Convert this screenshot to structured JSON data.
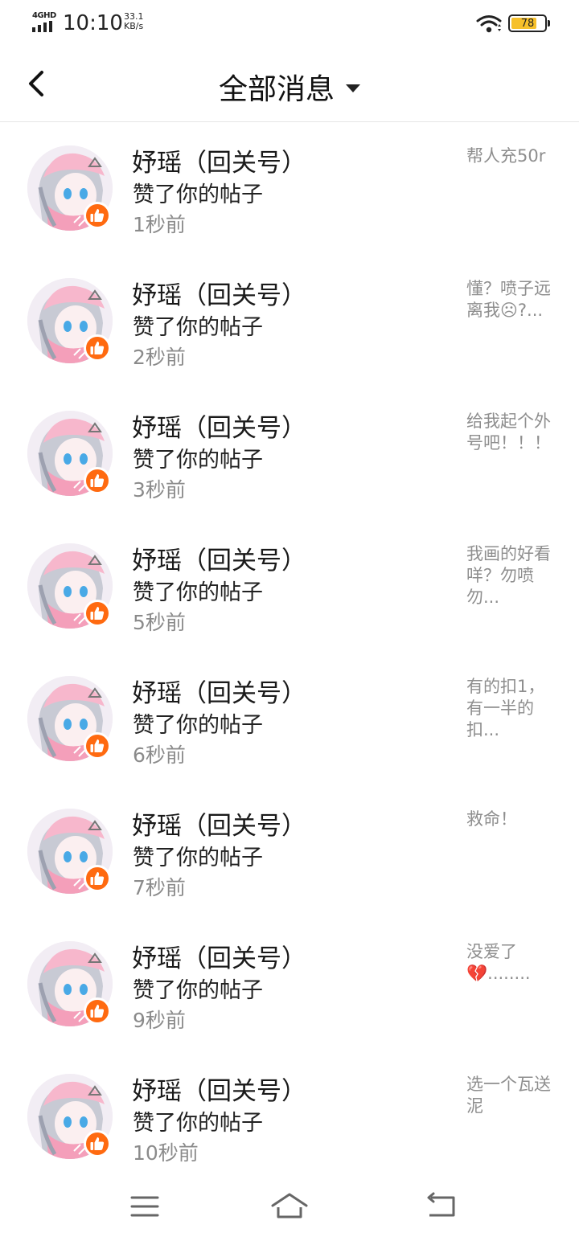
{
  "status_bar": {
    "network": "4GHD",
    "time": "10:10",
    "speed_value": "33.1",
    "speed_unit": "KB/s",
    "battery": "78",
    "battery_level": 0.78
  },
  "header": {
    "title": "全部消息"
  },
  "notifications": [
    {
      "name": "妤瑶（回关号）",
      "action": "赞了你的帖子",
      "time": "1秒前",
      "snippet": "帮人充50r"
    },
    {
      "name": "妤瑶（回关号）",
      "action": "赞了你的帖子",
      "time": "2秒前",
      "snippet": "懂？喷子远离我☹?..."
    },
    {
      "name": "妤瑶（回关号）",
      "action": "赞了你的帖子",
      "time": "3秒前",
      "snippet": "给我起个外号吧！！！"
    },
    {
      "name": "妤瑶（回关号）",
      "action": "赞了你的帖子",
      "time": "5秒前",
      "snippet": "我画的好看咩？勿喷勿..."
    },
    {
      "name": "妤瑶（回关号）",
      "action": "赞了你的帖子",
      "time": "6秒前",
      "snippet": "有的扣1，有一半的扣..."
    },
    {
      "name": "妤瑶（回关号）",
      "action": "赞了你的帖子",
      "time": "7秒前",
      "snippet": "救命！"
    },
    {
      "name": "妤瑶（回关号）",
      "action": "赞了你的帖子",
      "time": "9秒前",
      "snippet": "没爱了💔........"
    },
    {
      "name": "妤瑶（回关号）",
      "action": "赞了你的帖子",
      "time": "10秒前",
      "snippet": "选一个瓦送泥"
    }
  ],
  "colors": {
    "like_badge": "#ff6a10",
    "battery": "#f6c02b",
    "secondary_text": "#8b8b8b"
  }
}
